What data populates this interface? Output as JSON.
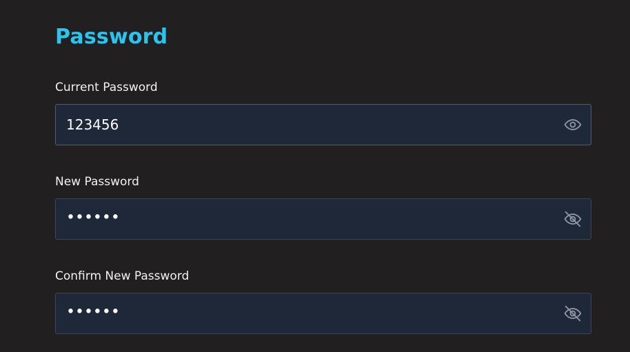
{
  "section": {
    "title": "Password"
  },
  "fields": [
    {
      "label": "Current Password",
      "value": "123456",
      "visible": true,
      "toggle_icon": "eye-icon"
    },
    {
      "label": "New Password",
      "value": "••••••",
      "visible": false,
      "toggle_icon": "eye-off-icon"
    },
    {
      "label": "Confirm New Password",
      "value": "••••••",
      "visible": false,
      "toggle_icon": "eye-off-icon"
    }
  ],
  "colors": {
    "background": "#211f1f",
    "accent": "#29c5f0",
    "input_bg": "#1f2839",
    "input_border": "#3d4657",
    "icon": "#8f96a3"
  }
}
